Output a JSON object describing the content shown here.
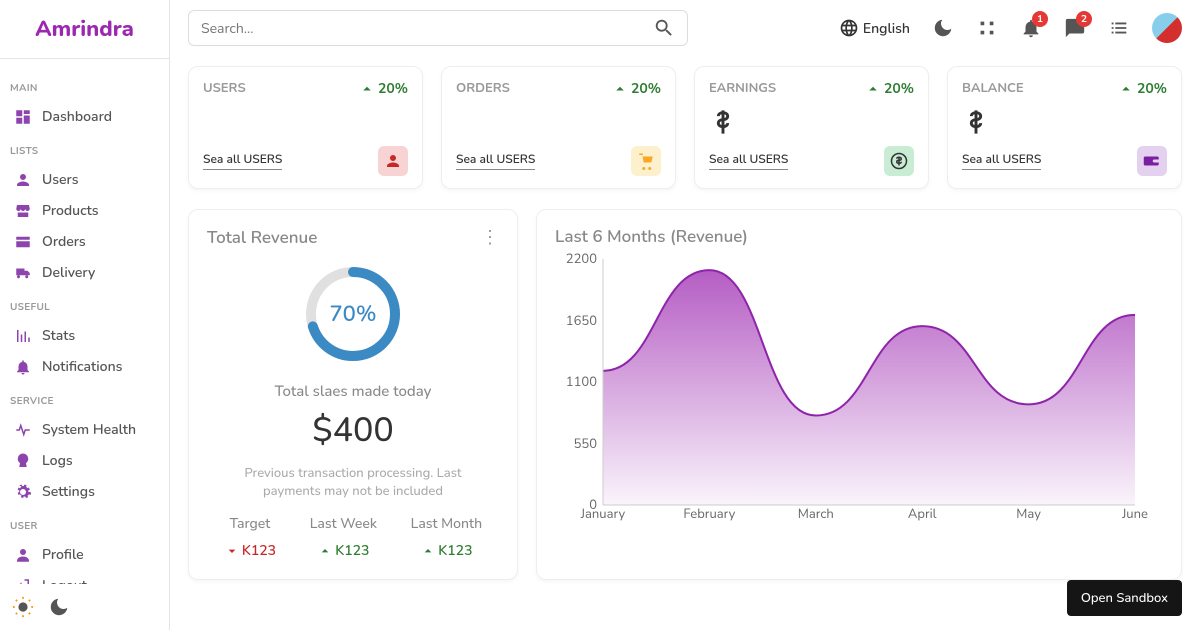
{
  "brand": "Amrindra",
  "search": {
    "placeholder": "Search..."
  },
  "topbar": {
    "language": "English",
    "notif_count": "1",
    "msg_count": "2"
  },
  "sidebar": {
    "groups": [
      {
        "title": "MAIN",
        "items": [
          {
            "label": "Dashboard",
            "icon": "dashboard"
          }
        ]
      },
      {
        "title": "LISTS",
        "items": [
          {
            "label": "Users",
            "icon": "person"
          },
          {
            "label": "Products",
            "icon": "store"
          },
          {
            "label": "Orders",
            "icon": "card"
          },
          {
            "label": "Delivery",
            "icon": "truck"
          }
        ]
      },
      {
        "title": "USEFUL",
        "items": [
          {
            "label": "Stats",
            "icon": "stats"
          },
          {
            "label": "Notifications",
            "icon": "bell"
          }
        ]
      },
      {
        "title": "SERVICE",
        "items": [
          {
            "label": "System Health",
            "icon": "health"
          },
          {
            "label": "Logs",
            "icon": "logs"
          },
          {
            "label": "Settings",
            "icon": "gear"
          }
        ]
      },
      {
        "title": "USER",
        "items": [
          {
            "label": "Profile",
            "icon": "profile"
          },
          {
            "label": "Logout",
            "icon": "logout"
          }
        ]
      }
    ]
  },
  "widgets": [
    {
      "title": "USERS",
      "pct": "20%",
      "value": "",
      "link": "Sea all USERS",
      "icon_class": "wi-red",
      "icon": "person"
    },
    {
      "title": "ORDERS",
      "pct": "20%",
      "value": "",
      "link": "Sea all USERS",
      "icon_class": "wi-yel",
      "icon": "cart"
    },
    {
      "title": "EARNINGS",
      "pct": "20%",
      "value": "$",
      "link": "Sea all USERS",
      "icon_class": "wi-grn",
      "icon": "dollar"
    },
    {
      "title": "BALANCE",
      "pct": "20%",
      "value": "$",
      "link": "Sea all USERS",
      "icon_class": "wi-pur",
      "icon": "wallet"
    }
  ],
  "revenue": {
    "title": "Total Revenue",
    "pct": "70%",
    "sub": "Total slaes made today",
    "amount": "$400",
    "note": "Previous transaction processing. Last payments may not be included",
    "cols": [
      {
        "title": "Target",
        "value": "K123",
        "dir": "dn"
      },
      {
        "title": "Last Week",
        "value": "K123",
        "dir": "up"
      },
      {
        "title": "Last Month",
        "value": "K123",
        "dir": "up"
      }
    ]
  },
  "chart_data": {
    "type": "area",
    "title": "Last 6 Months (Revenue)",
    "categories": [
      "January",
      "February",
      "March",
      "April",
      "May",
      "June"
    ],
    "values": [
      1200,
      2100,
      800,
      1600,
      900,
      1700
    ],
    "ylabel": "",
    "xlabel": "",
    "ylim": [
      0,
      2200
    ],
    "yticks": [
      0,
      550,
      1100,
      1650,
      2200
    ]
  },
  "sandbox_button": "Open Sandbox"
}
